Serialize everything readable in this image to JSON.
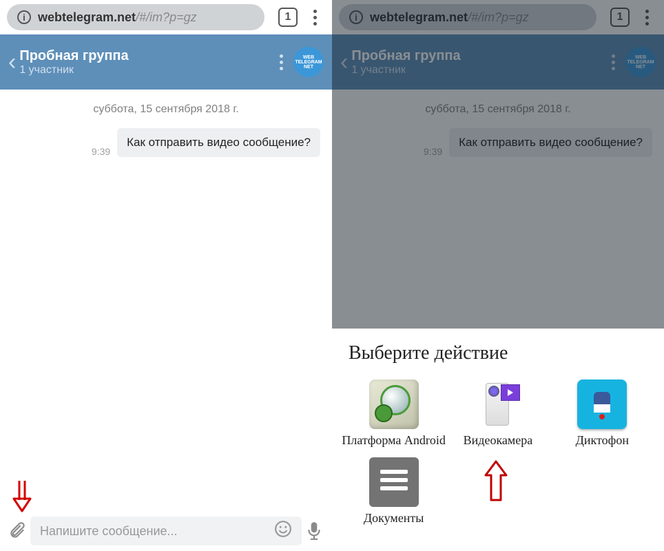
{
  "browser": {
    "domain": "webtelegram.net",
    "path": "/#/im?p=gz",
    "tab_count": "1"
  },
  "chat": {
    "title": "Пробная группа",
    "subtitle": "1 участник",
    "avatar_text": "WEB TELEGRAM NET"
  },
  "conversation": {
    "date_label": "суббота, 15 сентября 2018 г.",
    "msg_time": "9:39",
    "msg_text": "Как отправить видео сообщение?"
  },
  "input": {
    "placeholder": "Напишите сообщение..."
  },
  "sheet": {
    "title": "Выберите действие",
    "items": {
      "android": "Платформа Android",
      "camera": "Видеокамера",
      "mic": "Диктофон",
      "doc": "Документы"
    }
  }
}
